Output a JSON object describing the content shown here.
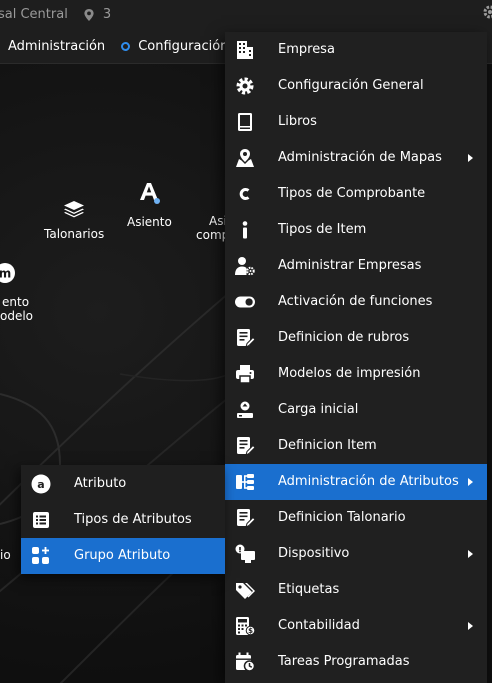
{
  "topbar": {
    "branch": "sal Central",
    "location_count": "3"
  },
  "navbar": {
    "admin_label": "Administración",
    "config_label": "Configuración"
  },
  "tiles": {
    "talonarios": "Talonarios",
    "asiento": "Asiento",
    "asiento_comp_line1": "Asi",
    "asiento_comp_line2": "comp",
    "asiento_modelo_line1": "ento",
    "asiento_modelo_line2": "odelo",
    "left_fragment": "io"
  },
  "menu": {
    "items": [
      {
        "label": "Empresa",
        "icon": "building-icon"
      },
      {
        "label": "Configuración General",
        "icon": "gear-icon"
      },
      {
        "label": "Libros",
        "icon": "book-icon"
      },
      {
        "label": "Administración de Mapas",
        "icon": "map-marker-icon",
        "submenu": true
      },
      {
        "label": "Tipos de Comprobante",
        "icon": "letter-c-icon"
      },
      {
        "label": "Tipos de Item",
        "icon": "info-icon"
      },
      {
        "label": "Administrar Empresas",
        "icon": "user-gear-icon"
      },
      {
        "label": "Activación de funciones",
        "icon": "toggle-icon"
      },
      {
        "label": "Definicion de rubros",
        "icon": "edit-doc-icon"
      },
      {
        "label": "Modelos de impresión",
        "icon": "printer-icon"
      },
      {
        "label": "Carga inicial",
        "icon": "upload-icon"
      },
      {
        "label": "Definicion Item",
        "icon": "edit-doc-icon"
      },
      {
        "label": "Administración de Atributos",
        "icon": "sitemap-icon",
        "submenu": true,
        "active": true
      },
      {
        "label": "Definicion Talonario",
        "icon": "edit-doc-icon"
      },
      {
        "label": "Dispositivo",
        "icon": "device-icon",
        "submenu": true
      },
      {
        "label": "Etiquetas",
        "icon": "tags-icon"
      },
      {
        "label": "Contabilidad",
        "icon": "calculator-icon",
        "submenu": true
      },
      {
        "label": "Tareas Programadas",
        "icon": "calendar-clock-icon"
      }
    ]
  },
  "submenu": {
    "items": [
      {
        "label": "Atributo",
        "icon": "letter-a-icon"
      },
      {
        "label": "Tipos de Atributos",
        "icon": "list-icon"
      },
      {
        "label": "Grupo Atributo",
        "icon": "grid-plus-icon",
        "active": true
      }
    ]
  },
  "colors": {
    "accent": "#1a6fcf",
    "menu_bg": "#202020",
    "bar_bg": "#1e1e1e",
    "nav_dot": "#2f8ded"
  }
}
